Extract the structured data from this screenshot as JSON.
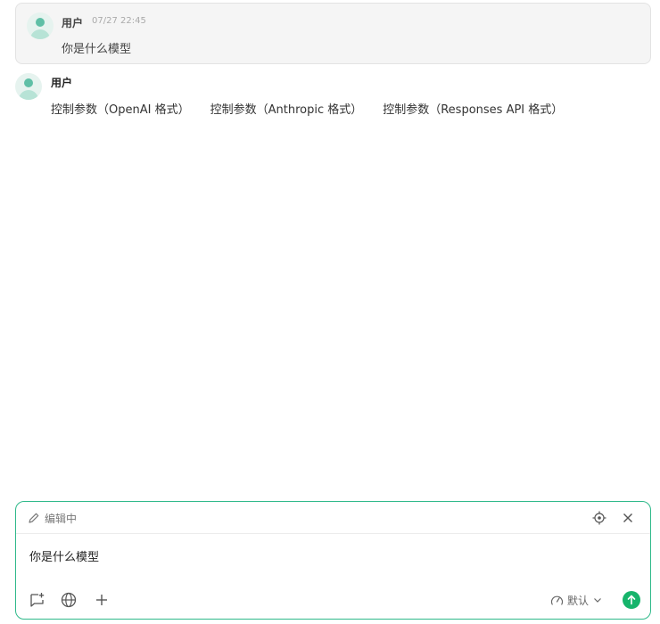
{
  "messages": [
    {
      "author": "用户",
      "timestamp": "07/27 22:45",
      "content": "你是什么模型"
    },
    {
      "author": "用户",
      "chips": [
        "控制参数（OpenAI 格式）",
        "控制参数（Anthropic 格式）",
        "控制参数（Responses API 格式）"
      ]
    }
  ],
  "composer": {
    "status_label": "编辑中",
    "text": "你是什么模型",
    "mode_label": "默认",
    "icons": {
      "edit": "pencil-icon",
      "target": "crosshair-icon",
      "close": "close-icon",
      "tool1": "chat-add-icon",
      "tool2": "globe-icon",
      "tool3": "plus-icon",
      "mode": "gauge-icon",
      "dropdown": "chevron-down-icon",
      "send": "arrow-up-icon"
    }
  },
  "colors": {
    "accent": "#2fb98a",
    "send": "#16b46b",
    "avatar": "#5fbfa6"
  }
}
